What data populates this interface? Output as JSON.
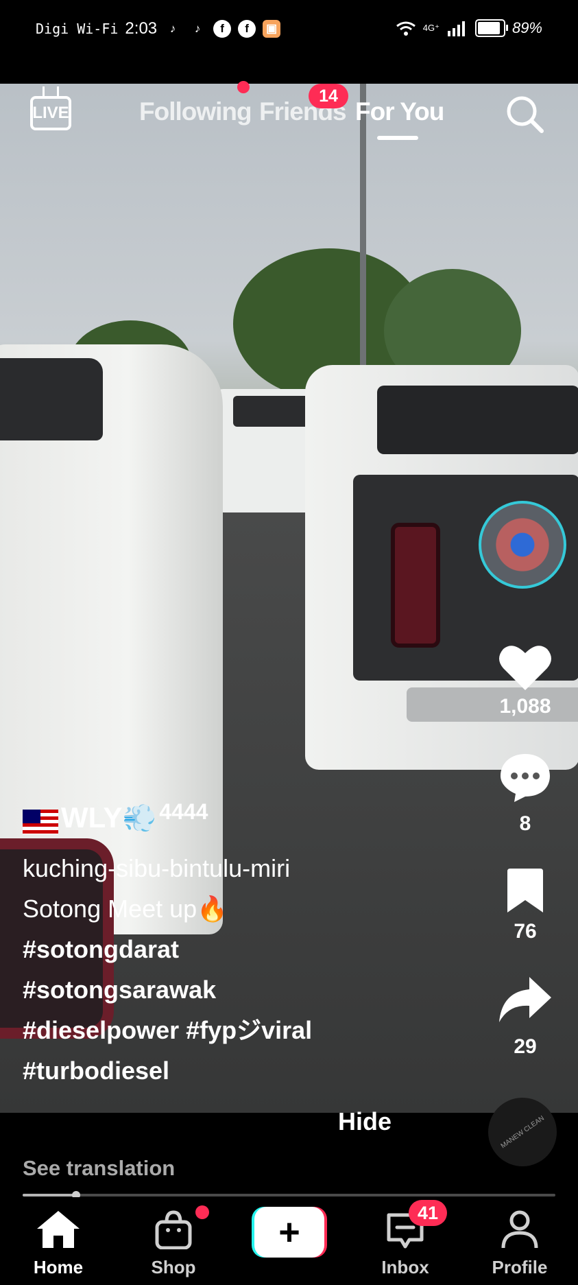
{
  "status_bar": {
    "carrier": "Digi Wi-Fi",
    "time": "2:03",
    "network": "4G⁺",
    "battery_pct": "89%",
    "battery_level": 0.89,
    "notification_icons": [
      "tiktok-icon",
      "tiktok-icon",
      "facebook-icon",
      "facebook-icon",
      "shopee-icon"
    ]
  },
  "top_nav": {
    "live_label": "LIVE",
    "tabs": [
      {
        "label": "Following",
        "active": false
      },
      {
        "label": "Friends",
        "active": false,
        "badge": "14"
      },
      {
        "label": "For You",
        "active": true
      }
    ]
  },
  "actions": {
    "likes": "1,088",
    "comments": "8",
    "saves": "76",
    "shares": "29"
  },
  "caption": {
    "username": "WLY",
    "username_suffix": "4444",
    "line1": "kuching-sibu-bintulu-miri",
    "line2": "Sotong Meet up🔥",
    "hashtags": [
      "#sotongdarat",
      "#sotongsarawak",
      "#dieselpower #fypジviral",
      "#turbodiesel"
    ],
    "hide_label": "Hide",
    "see_translation": "See translation"
  },
  "progress": {
    "played_fraction": 0.1
  },
  "bottom_nav": {
    "items": [
      {
        "label": "Home",
        "active": true
      },
      {
        "label": "Shop",
        "active": false
      },
      {
        "label": "Inbox",
        "active": false,
        "badge": "41"
      },
      {
        "label": "Profile",
        "active": false
      }
    ]
  },
  "colors": {
    "accent_red": "#fe2c55",
    "accent_cyan": "#25f4ee",
    "disc_ring": "#35c9d8"
  }
}
